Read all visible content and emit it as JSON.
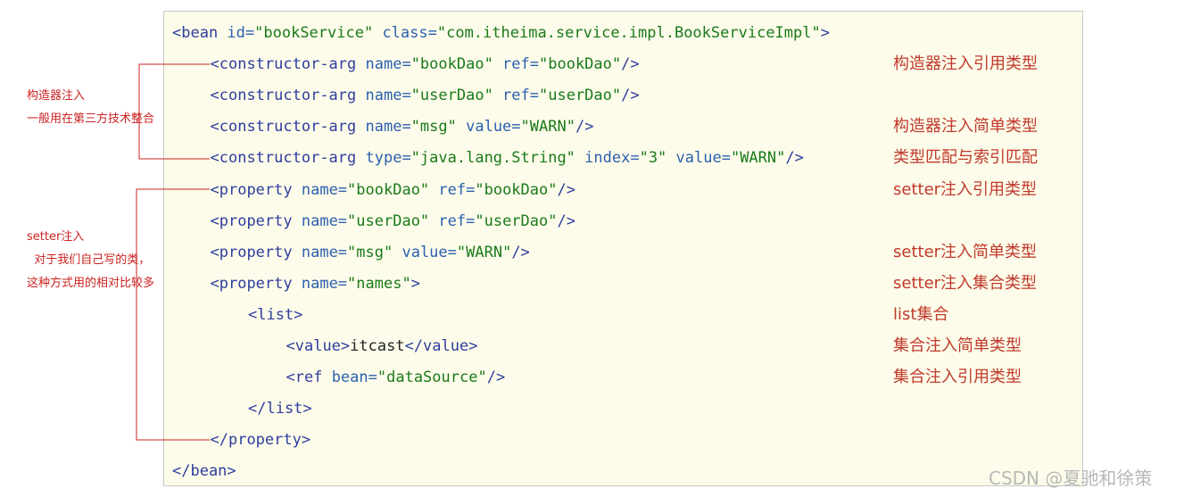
{
  "code_lines": [
    {
      "indent": 0,
      "parts": [
        {
          "t": "tag",
          "v": "<bean "
        },
        {
          "t": "attr",
          "v": "id="
        },
        {
          "t": "val",
          "v": "\"bookService\" "
        },
        {
          "t": "attr",
          "v": "class="
        },
        {
          "t": "val",
          "v": "\"com.itheima.service.impl.BookServiceImpl\""
        },
        {
          "t": "tag",
          "v": ">"
        }
      ]
    },
    {
      "indent": 1,
      "parts": [
        {
          "t": "tag",
          "v": "<constructor-arg "
        },
        {
          "t": "attr",
          "v": "name="
        },
        {
          "t": "val",
          "v": "\"bookDao\" "
        },
        {
          "t": "attr",
          "v": "ref="
        },
        {
          "t": "val",
          "v": "\"bookDao\""
        },
        {
          "t": "tag",
          "v": "/>"
        }
      ]
    },
    {
      "indent": 1,
      "parts": [
        {
          "t": "tag",
          "v": "<constructor-arg "
        },
        {
          "t": "attr",
          "v": "name="
        },
        {
          "t": "val",
          "v": "\"userDao\" "
        },
        {
          "t": "attr",
          "v": "ref="
        },
        {
          "t": "val",
          "v": "\"userDao\""
        },
        {
          "t": "tag",
          "v": "/>"
        }
      ]
    },
    {
      "indent": 1,
      "parts": [
        {
          "t": "tag",
          "v": "<constructor-arg "
        },
        {
          "t": "attr",
          "v": "name="
        },
        {
          "t": "val",
          "v": "\"msg\" "
        },
        {
          "t": "attr",
          "v": "value="
        },
        {
          "t": "val",
          "v": "\"WARN\""
        },
        {
          "t": "tag",
          "v": "/>"
        }
      ]
    },
    {
      "indent": 1,
      "parts": [
        {
          "t": "tag",
          "v": "<constructor-arg "
        },
        {
          "t": "attr",
          "v": "type="
        },
        {
          "t": "val",
          "v": "\"java.lang.String\" "
        },
        {
          "t": "attr",
          "v": "index="
        },
        {
          "t": "val",
          "v": "\"3\" "
        },
        {
          "t": "attr",
          "v": "value="
        },
        {
          "t": "val",
          "v": "\"WARN\""
        },
        {
          "t": "tag",
          "v": "/>"
        }
      ]
    },
    {
      "indent": 1,
      "parts": [
        {
          "t": "tag",
          "v": "<property "
        },
        {
          "t": "attr",
          "v": "name="
        },
        {
          "t": "val",
          "v": "\"bookDao\" "
        },
        {
          "t": "attr",
          "v": "ref="
        },
        {
          "t": "val",
          "v": "\"bookDao\""
        },
        {
          "t": "tag",
          "v": "/>"
        }
      ]
    },
    {
      "indent": 1,
      "parts": [
        {
          "t": "tag",
          "v": "<property "
        },
        {
          "t": "attr",
          "v": "name="
        },
        {
          "t": "val",
          "v": "\"userDao\" "
        },
        {
          "t": "attr",
          "v": "ref="
        },
        {
          "t": "val",
          "v": "\"userDao\""
        },
        {
          "t": "tag",
          "v": "/>"
        }
      ]
    },
    {
      "indent": 1,
      "parts": [
        {
          "t": "tag",
          "v": "<property "
        },
        {
          "t": "attr",
          "v": "name="
        },
        {
          "t": "val",
          "v": "\"msg\" "
        },
        {
          "t": "attr",
          "v": "value="
        },
        {
          "t": "val",
          "v": "\"WARN\""
        },
        {
          "t": "tag",
          "v": "/>"
        }
      ]
    },
    {
      "indent": 1,
      "parts": [
        {
          "t": "tag",
          "v": "<property "
        },
        {
          "t": "attr",
          "v": "name="
        },
        {
          "t": "val",
          "v": "\"names\""
        },
        {
          "t": "tag",
          "v": ">"
        }
      ]
    },
    {
      "indent": 2,
      "parts": [
        {
          "t": "tag",
          "v": "<list>"
        }
      ]
    },
    {
      "indent": 3,
      "parts": [
        {
          "t": "tag",
          "v": "<value>"
        },
        {
          "t": "plain",
          "v": "itcast"
        },
        {
          "t": "tag",
          "v": "</value>"
        }
      ]
    },
    {
      "indent": 3,
      "parts": [
        {
          "t": "tag",
          "v": "<ref "
        },
        {
          "t": "attr",
          "v": "bean="
        },
        {
          "t": "val",
          "v": "\"dataSource\""
        },
        {
          "t": "tag",
          "v": "/>"
        }
      ]
    },
    {
      "indent": 2,
      "parts": [
        {
          "t": "tag",
          "v": "</list>"
        }
      ]
    },
    {
      "indent": 1,
      "parts": [
        {
          "t": "tag",
          "v": "</property>"
        }
      ]
    },
    {
      "indent": 0,
      "parts": [
        {
          "t": "tag",
          "v": "</bean>"
        }
      ]
    }
  ],
  "annotations": [
    {
      "line": 1,
      "text": "构造器注入引用类型"
    },
    {
      "line": 3,
      "text": "构造器注入简单类型"
    },
    {
      "line": 4,
      "text": "类型匹配与索引匹配"
    },
    {
      "line": 5,
      "text": "setter注入引用类型"
    },
    {
      "line": 7,
      "text": "setter注入简单类型"
    },
    {
      "line": 8,
      "text": "setter注入集合类型"
    },
    {
      "line": 9,
      "text": "list集合"
    },
    {
      "line": 10,
      "text": "集合注入简单类型"
    },
    {
      "line": 11,
      "text": "集合注入引用类型"
    }
  ],
  "side_notes": {
    "constructor": {
      "title": "构造器注入",
      "desc": "一般用在第三方技术整合"
    },
    "setter": {
      "title": "setter注入",
      "desc1": "  对于我们自己写的类，",
      "desc2": "这种方式用的相对比较多"
    }
  },
  "watermark": "CSDN @夏驰和徐策",
  "colors": {
    "tag": "#2e3d9e",
    "attr": "#2c5fb0",
    "value": "#1a7a1a",
    "annotation": "#c0392b",
    "bracket": "#cc2222",
    "background": "#fdfcea"
  }
}
